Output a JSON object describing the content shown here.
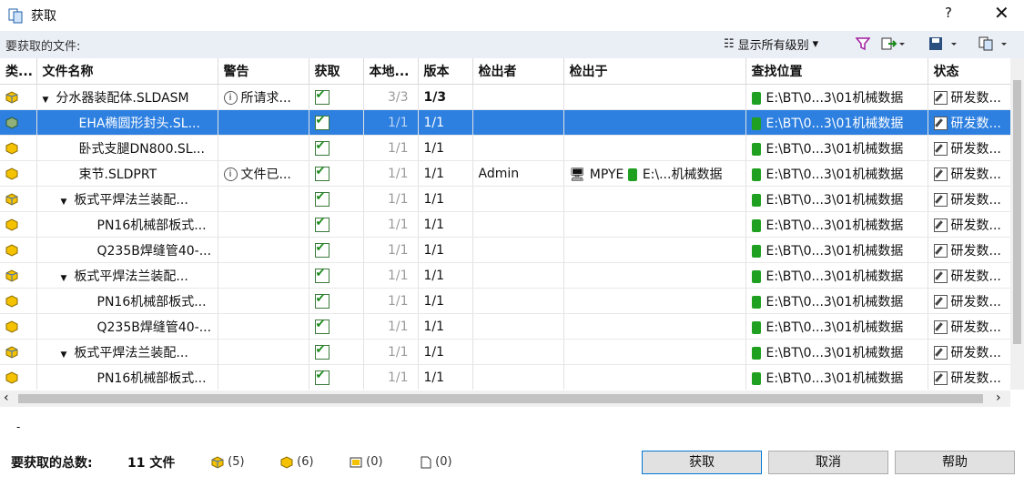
{
  "window": {
    "title": "获取",
    "help": "?",
    "close": "✕"
  },
  "toolbar": {
    "label": "要获取的文件:",
    "level": "显示所有级别"
  },
  "columns": [
    "类...",
    "文件名称",
    "警告",
    "获取",
    "本地...",
    "版本",
    "检出者",
    "检出于",
    "查找位置",
    "状态"
  ],
  "rows": [
    {
      "name": "分水器装配体.SLDASM",
      "warning": "所请求...",
      "local": "3/3",
      "version": "1/3",
      "checked_by": "",
      "checked_at": "",
      "location": "E:\\BT\\0...3\\01机械数据",
      "status": "研发数..."
    },
    {
      "name": "EHA椭圆形封头.SL...",
      "warning": "",
      "local": "1/1",
      "version": "1/1",
      "checked_by": "",
      "checked_at": "",
      "location": "E:\\BT\\0...3\\01机械数据",
      "status": "研发数..."
    },
    {
      "name": "卧式支腿DN800.SL...",
      "warning": "",
      "local": "1/1",
      "version": "1/1",
      "checked_by": "",
      "checked_at": "",
      "location": "E:\\BT\\0...3\\01机械数据",
      "status": "研发数..."
    },
    {
      "name": "束节.SLDPRT",
      "warning": "文件已...",
      "local": "1/1",
      "version": "1/1",
      "checked_by": "Admin",
      "checked_at": "MPYE",
      "checked_at_path": "E:\\...机械数据",
      "location": "E:\\BT\\0...3\\01机械数据",
      "status": "研发数..."
    },
    {
      "name": "板式平焊法兰装配...",
      "warning": "",
      "local": "1/1",
      "version": "1/1",
      "checked_by": "",
      "checked_at": "",
      "location": "E:\\BT\\0...3\\01机械数据",
      "status": "研发数..."
    },
    {
      "name": "PN16机械部板式...",
      "warning": "",
      "local": "1/1",
      "version": "1/1",
      "checked_by": "",
      "checked_at": "",
      "location": "E:\\BT\\0...3\\01机械数据",
      "status": "研发数..."
    },
    {
      "name": "Q235B焊缝管40-...",
      "warning": "",
      "local": "1/1",
      "version": "1/1",
      "checked_by": "",
      "checked_at": "",
      "location": "E:\\BT\\0...3\\01机械数据",
      "status": "研发数..."
    },
    {
      "name": "板式平焊法兰装配...",
      "warning": "",
      "local": "1/1",
      "version": "1/1",
      "checked_by": "",
      "checked_at": "",
      "location": "E:\\BT\\0...3\\01机械数据",
      "status": "研发数..."
    },
    {
      "name": "PN16机械部板式...",
      "warning": "",
      "local": "1/1",
      "version": "1/1",
      "checked_by": "",
      "checked_at": "",
      "location": "E:\\BT\\0...3\\01机械数据",
      "status": "研发数..."
    },
    {
      "name": "Q235B焊缝管40-...",
      "warning": "",
      "local": "1/1",
      "version": "1/1",
      "checked_by": "",
      "checked_at": "",
      "location": "E:\\BT\\0...3\\01机械数据",
      "status": "研发数..."
    },
    {
      "name": "板式平焊法兰装配...",
      "warning": "",
      "local": "1/1",
      "version": "1/1",
      "checked_by": "",
      "checked_at": "",
      "location": "E:\\BT\\0...3\\01机械数据",
      "status": "研发数..."
    },
    {
      "name": "PN16机械部板式...",
      "warning": "",
      "local": "1/1",
      "version": "1/1",
      "checked_by": "",
      "checked_at": "",
      "location": "E:\\BT\\0...3\\01机械数据",
      "status": "研发数..."
    }
  ],
  "footer": {
    "dash": "-",
    "total_label": "要获取的总数:",
    "total_value": "11 文件",
    "stat1": "(5)",
    "stat2": "(6)",
    "stat3": "(0)",
    "stat4": "(0)",
    "get_button": "获取",
    "cancel_button": "取消",
    "help_button": "帮助"
  }
}
